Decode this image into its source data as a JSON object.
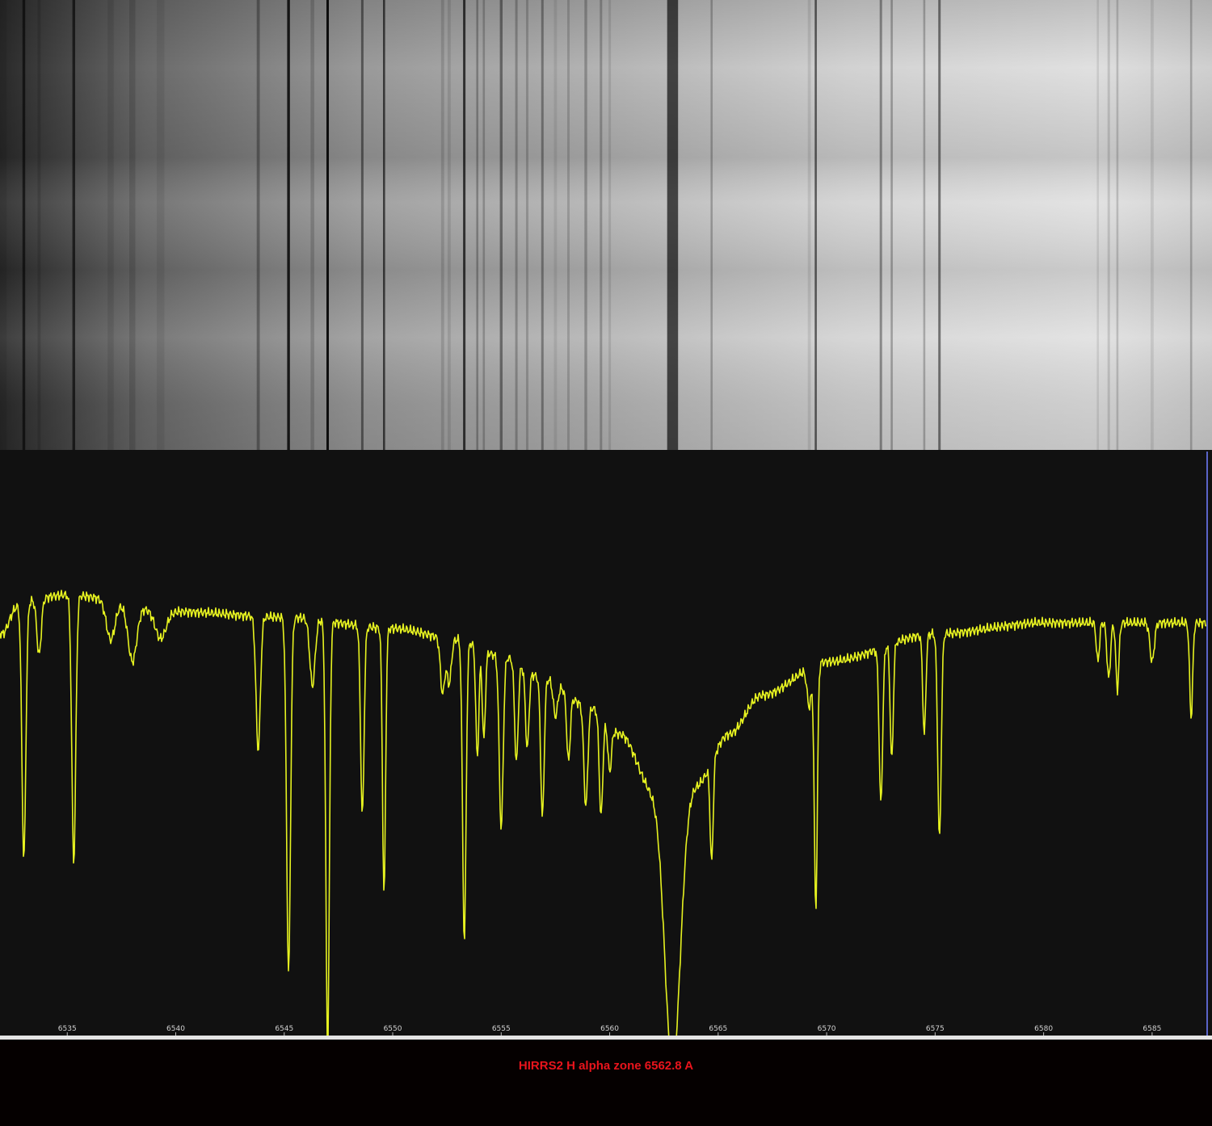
{
  "caption": "HIRRS2 H alpha zone 6562.8 A",
  "colors": {
    "trace": "#e6f220",
    "plot_background": "#111111",
    "caption": "#e8141c",
    "axis_strip": "#e4e4e4",
    "right_marker": "#5a64c8"
  },
  "chart_data": {
    "type": "line",
    "title": "",
    "xlabel": "",
    "ylabel": "",
    "x_unit": "angstrom",
    "xlim": [
      6531.9,
      6587.5
    ],
    "ylim": [
      0.0,
      1.05
    ],
    "grid": false,
    "x_ticks": [
      6535,
      6540,
      6545,
      6550,
      6555,
      6560,
      6565,
      6570,
      6575,
      6580,
      6585
    ],
    "x_tick_labels": [
      "6535",
      "6540",
      "6545",
      "6550",
      "6555",
      "6560",
      "6565",
      "6570",
      "6575",
      "6580",
      "6585"
    ],
    "continuum": {
      "x": [
        6531.9,
        6535,
        6540,
        6545,
        6550,
        6553,
        6555,
        6557,
        6559,
        6560.5,
        6562,
        6564,
        6565.5,
        6567,
        6570,
        6575,
        6580,
        6585,
        6587.5
      ],
      "y": [
        0.77,
        0.79,
        0.76,
        0.75,
        0.73,
        0.71,
        0.68,
        0.64,
        0.59,
        0.54,
        0.44,
        0.45,
        0.54,
        0.61,
        0.67,
        0.72,
        0.74,
        0.74,
        0.74
      ]
    },
    "absorption_lines": [
      {
        "x": 6532.0,
        "depth": 0.05,
        "width": 0.3
      },
      {
        "x": 6533.0,
        "depth": 0.46,
        "width": 0.09
      },
      {
        "x": 6533.7,
        "depth": 0.1,
        "width": 0.1
      },
      {
        "x": 6535.3,
        "depth": 0.48,
        "width": 0.09
      },
      {
        "x": 6537.0,
        "depth": 0.07,
        "width": 0.2
      },
      {
        "x": 6538.0,
        "depth": 0.1,
        "width": 0.2
      },
      {
        "x": 6539.3,
        "depth": 0.05,
        "width": 0.25
      },
      {
        "x": 6543.8,
        "depth": 0.24,
        "width": 0.1
      },
      {
        "x": 6545.2,
        "depth": 0.64,
        "width": 0.09
      },
      {
        "x": 6546.3,
        "depth": 0.12,
        "width": 0.12
      },
      {
        "x": 6547.0,
        "depth": 0.77,
        "width": 0.08
      },
      {
        "x": 6548.6,
        "depth": 0.34,
        "width": 0.08
      },
      {
        "x": 6549.6,
        "depth": 0.48,
        "width": 0.07
      },
      {
        "x": 6552.3,
        "depth": 0.1,
        "width": 0.1
      },
      {
        "x": 6552.6,
        "depth": 0.08,
        "width": 0.1
      },
      {
        "x": 6553.3,
        "depth": 0.54,
        "width": 0.08
      },
      {
        "x": 6553.9,
        "depth": 0.2,
        "width": 0.07
      },
      {
        "x": 6554.2,
        "depth": 0.16,
        "width": 0.07
      },
      {
        "x": 6555.0,
        "depth": 0.31,
        "width": 0.09
      },
      {
        "x": 6555.7,
        "depth": 0.18,
        "width": 0.08
      },
      {
        "x": 6556.2,
        "depth": 0.14,
        "width": 0.08
      },
      {
        "x": 6556.9,
        "depth": 0.25,
        "width": 0.08
      },
      {
        "x": 6557.5,
        "depth": 0.06,
        "width": 0.1
      },
      {
        "x": 6558.1,
        "depth": 0.12,
        "width": 0.08
      },
      {
        "x": 6558.9,
        "depth": 0.18,
        "width": 0.09
      },
      {
        "x": 6559.6,
        "depth": 0.18,
        "width": 0.08
      },
      {
        "x": 6560.0,
        "depth": 0.08,
        "width": 0.08
      },
      {
        "x": 6562.9,
        "depth": 0.5,
        "width": 0.36
      },
      {
        "x": 6564.7,
        "depth": 0.18,
        "width": 0.07
      },
      {
        "x": 6569.2,
        "depth": 0.07,
        "width": 0.1
      },
      {
        "x": 6569.5,
        "depth": 0.44,
        "width": 0.07
      },
      {
        "x": 6572.5,
        "depth": 0.28,
        "width": 0.08
      },
      {
        "x": 6573.0,
        "depth": 0.21,
        "width": 0.07
      },
      {
        "x": 6574.5,
        "depth": 0.18,
        "width": 0.07
      },
      {
        "x": 6575.2,
        "depth": 0.37,
        "width": 0.08
      },
      {
        "x": 6582.5,
        "depth": 0.07,
        "width": 0.07
      },
      {
        "x": 6583.0,
        "depth": 0.1,
        "width": 0.08
      },
      {
        "x": 6583.4,
        "depth": 0.12,
        "width": 0.07
      },
      {
        "x": 6585.0,
        "depth": 0.07,
        "width": 0.1
      },
      {
        "x": 6586.8,
        "depth": 0.17,
        "width": 0.07
      }
    ]
  }
}
